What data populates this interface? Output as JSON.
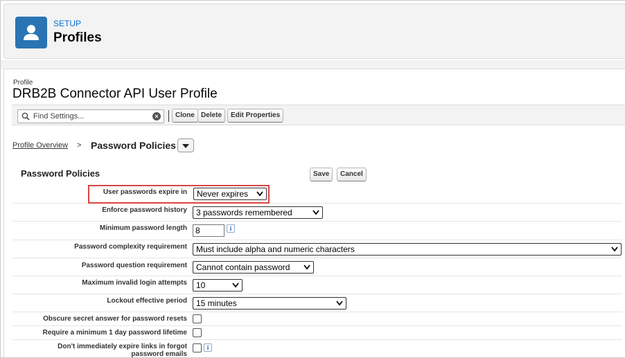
{
  "header": {
    "eyebrow": "SETUP",
    "title": "Profiles",
    "icon": "user-icon",
    "icon_bg_color": "#2a74b3"
  },
  "profile": {
    "label": "Profile",
    "name": "DRB2B Connector API User Profile"
  },
  "toolbar": {
    "search_placeholder": "Find Settings...",
    "buttons": [
      "Clone",
      "Delete",
      "Edit Properties"
    ]
  },
  "breadcrumb": {
    "parent": "Profile Overview",
    "separator": ">",
    "current": "Password Policies"
  },
  "section": {
    "title": "Password Policies",
    "save_label": "Save",
    "cancel_label": "Cancel"
  },
  "fields": [
    {
      "label": "User passwords expire in",
      "type": "select",
      "value": "Never expires",
      "highlighted": true
    },
    {
      "label": "Enforce password history",
      "type": "select",
      "value": "3 passwords remembered"
    },
    {
      "label": "Minimum password length",
      "type": "text",
      "value": "8",
      "info": "i"
    },
    {
      "label": "Password complexity requirement",
      "type": "select",
      "value": "Must include alpha and numeric characters"
    },
    {
      "label": "Password question requirement",
      "type": "select",
      "value": "Cannot contain password"
    },
    {
      "label": "Maximum invalid login attempts",
      "type": "select",
      "value": "10"
    },
    {
      "label": "Lockout effective period",
      "type": "select",
      "value": "15 minutes"
    },
    {
      "label": "Obscure secret answer for password resets",
      "type": "checkbox",
      "checked": false
    },
    {
      "label": "Require a minimum 1 day password lifetime",
      "type": "checkbox",
      "checked": false
    },
    {
      "label": "Don't immediately expire links in forgot password emails",
      "type": "checkbox",
      "checked": false,
      "info": "i"
    }
  ],
  "colors": {
    "link": "#0070d2",
    "highlight_border": "#d9453f"
  }
}
